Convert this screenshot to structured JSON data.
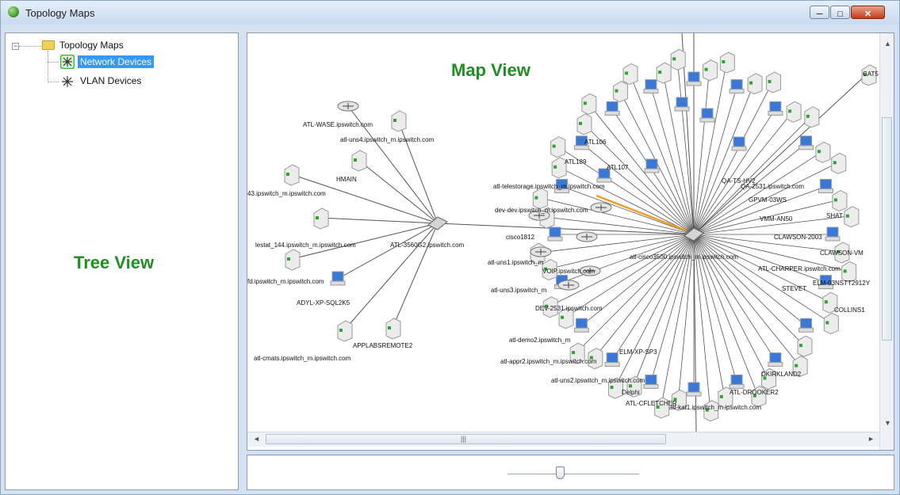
{
  "window": {
    "title": "Topology Maps"
  },
  "tree": {
    "root_label": "Topology Maps",
    "items": [
      {
        "label": "Network Devices",
        "selected": true
      },
      {
        "label": "VLAN Devices",
        "selected": false
      }
    ],
    "annotation": "Tree View"
  },
  "map": {
    "annotation": "Map View",
    "edge_highlight_color": "#f0a020",
    "labels": [
      "ATL-WASE.ipswitch.com",
      "atl-uns4.ipswitch_m.ipswitch.com",
      "HMAIN",
      "43.ipswitch_m.ipswitch.com",
      "lestat_144.ipswitch_m.ipswitch.com",
      "ATL-3560G2.ipswitch.com",
      "fd.ipswitch_m.ipswitch.com",
      "ADYL-XP-SQL2K5",
      "APPLABSREMOTE2",
      "atl-cmats.ipswitch_m.ipswitch.com",
      "atl-telestorage.ipswitch_m.ipswitch.com",
      "dev-dev.ipswitch_m.ipswitch.com",
      "cisco1812",
      "atl-uns1.ipswitch_m",
      "VOIP.ipswitch.com",
      "atl-uns3.ipswitch_m",
      "DEV-2531.ipswitch.com",
      "atl-demo2.ipswitch_m",
      "ELM-XP-SP3",
      "atl-appr2.ipswitch_m.ipswitch.com",
      "atl-uns2.ipswitch_m.ipswitch.com",
      "Delphi",
      "ATL-CFLETCHER",
      "atl-kat1.ipswitch_m.ipswitch.com",
      "ATL106",
      "ATL189",
      "ATL107",
      "QA-2531.ipswitch.com",
      "QA-TS-HV2",
      "GPVM-03WS",
      "VMM-AN50",
      "SHAT",
      "CLAWSON-2003",
      "CLAWSON-VM",
      "ATL-CHARPER.ipswitch.com",
      "STEVET",
      "ELM-03NSTT2912Y",
      "ATL-DROOKER2",
      "DKIRKLAND2",
      "COLLINS1",
      "atl-cisco3500.ipswitch_m.ipswitch.com",
      "CAT5"
    ]
  },
  "zoom": {
    "level_fraction": 0.4
  }
}
